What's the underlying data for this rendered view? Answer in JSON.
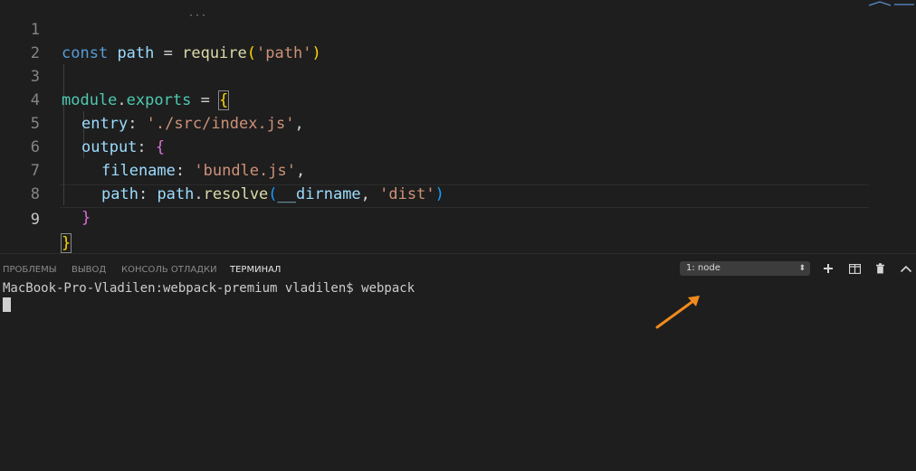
{
  "editor": {
    "line_numbers": [
      "1",
      "2",
      "3",
      "4",
      "5",
      "6",
      "7",
      "8",
      "9"
    ],
    "l1": {
      "kw": "const",
      "name": "path",
      "eq": " = ",
      "fn": "require",
      "open": "(",
      "arg": "'path'",
      "close": ")"
    },
    "l3": {
      "obj": "module",
      "dot": ".",
      "prop": "exports",
      "eq": " = ",
      "brace": "{"
    },
    "l4": {
      "key": "entry",
      "colon": ": ",
      "val": "'./src/index.js'",
      "comma": ","
    },
    "l5": {
      "key": "output",
      "colon": ": ",
      "brace": "{"
    },
    "l6": {
      "key": "filename",
      "colon": ": ",
      "val": "'bundle.js'",
      "comma": ","
    },
    "l7": {
      "key": "path",
      "colon": ": ",
      "obj": "path",
      "dot": ".",
      "fn": "resolve",
      "open": "(",
      "arg1": "__dirname",
      "sep": ", ",
      "arg2": "'dist'",
      "close": ")"
    },
    "l8": {
      "brace": "}"
    },
    "l9": {
      "brace": "}"
    }
  },
  "panel": {
    "tabs": [
      "ПРОБЛЕМЫ",
      "ВЫВОД",
      "КОНСОЛЬ ОТЛАДКИ",
      "ТЕРМИНАЛ"
    ],
    "active_tab": "ТЕРМИНАЛ",
    "terminal_select": "1: node",
    "terminal_prompt": "MacBook-Pro-Vladilen:webpack-premium vladilen$ webpack"
  },
  "icons": {
    "add": "plus-icon",
    "split": "split-terminal-icon",
    "trash": "trash-icon",
    "maximize": "chevron-up-icon",
    "annotation": "orange-arrow"
  },
  "colors": {
    "annotation_arrow": "#f28a1e",
    "background": "#1e1e1e"
  }
}
